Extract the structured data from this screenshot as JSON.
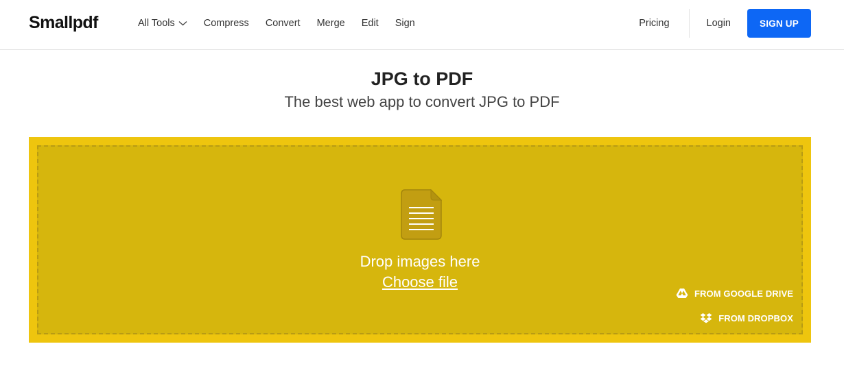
{
  "header": {
    "logo": "Smallpdf",
    "nav": [
      {
        "label": "All Tools"
      },
      {
        "label": "Compress"
      },
      {
        "label": "Convert"
      },
      {
        "label": "Merge"
      },
      {
        "label": "Edit"
      },
      {
        "label": "Sign"
      }
    ],
    "pricing": "Pricing",
    "login": "Login",
    "signup": "SIGN UP"
  },
  "hero": {
    "title": "JPG to PDF",
    "subtitle": "The best web app to convert JPG to PDF"
  },
  "dropzone": {
    "drop_text": "Drop images here",
    "choose_file": "Choose file",
    "google_drive": "FROM GOOGLE DRIVE",
    "dropbox": "FROM DROPBOX"
  },
  "colors": {
    "accent_blue": "#0d67f5",
    "dropzone_fill": "#d6b60d",
    "dropzone_border": "#eec50e"
  },
  "icons": {
    "chevron": "chevron-down-icon",
    "file": "document-icon",
    "google_drive": "google-drive-icon",
    "dropbox": "dropbox-icon"
  }
}
